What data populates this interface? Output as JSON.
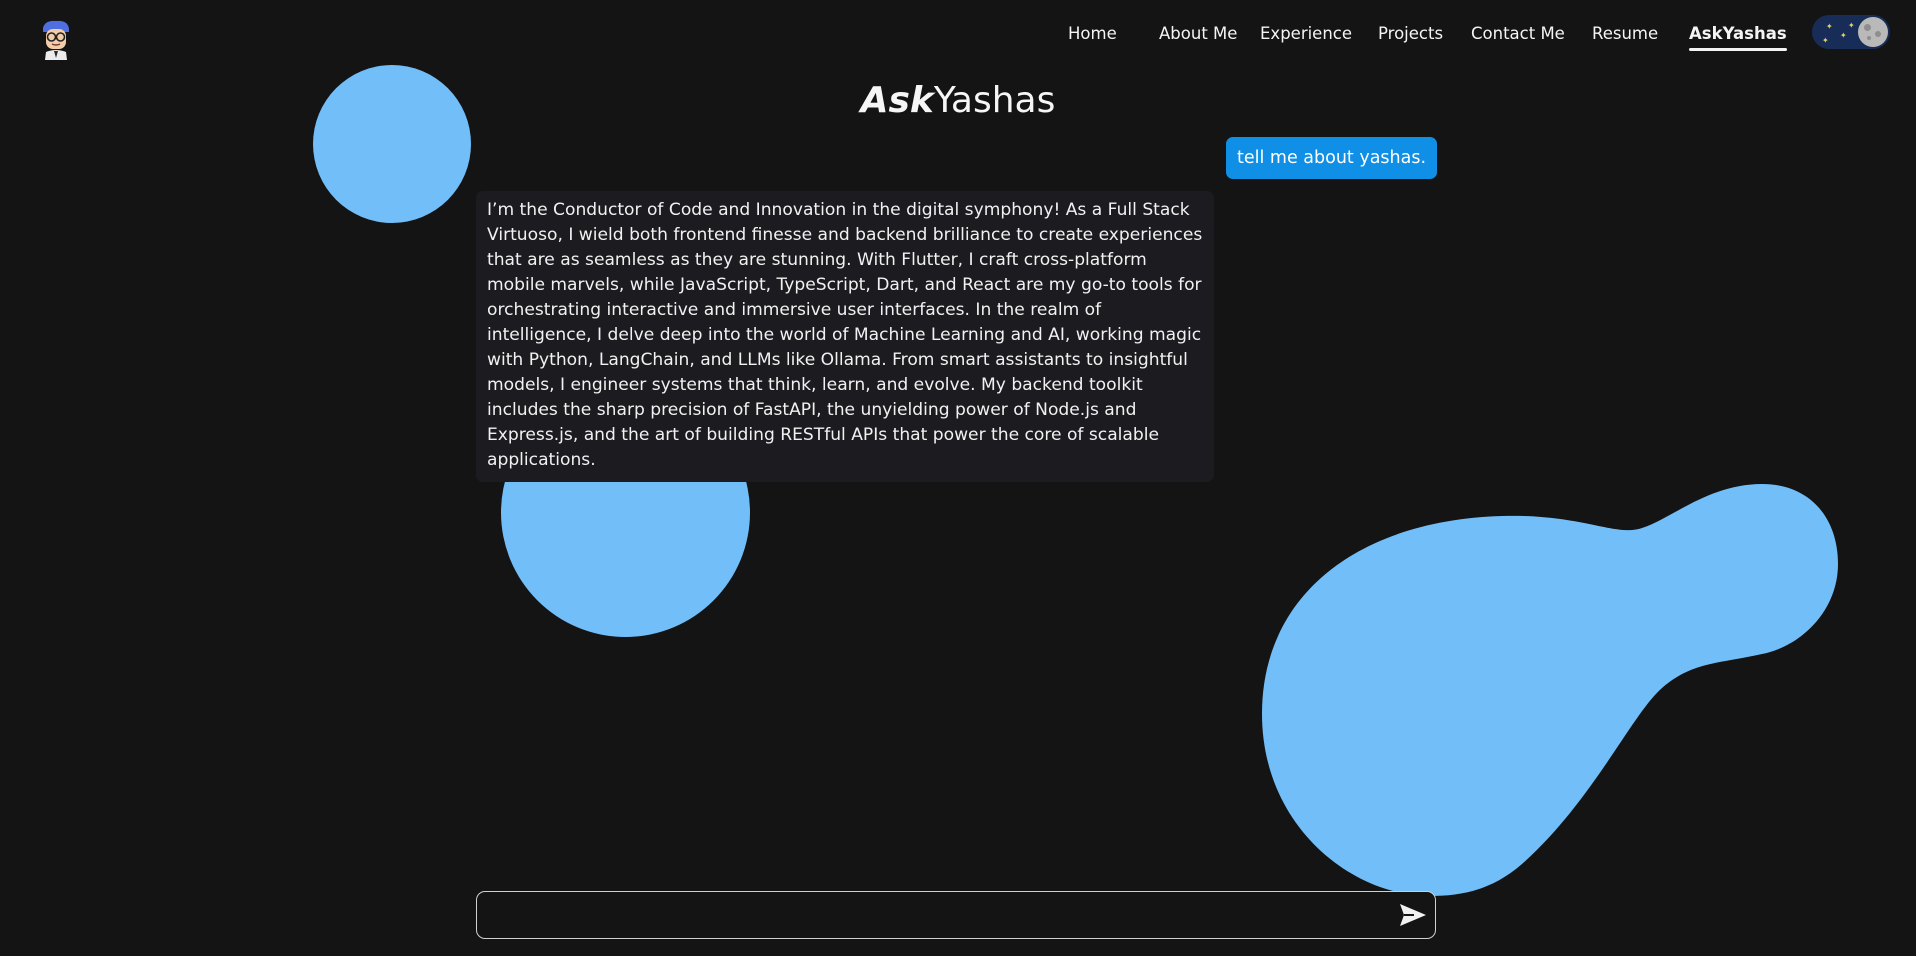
{
  "nav": {
    "items": [
      {
        "label": "Home"
      },
      {
        "label": "About Me"
      },
      {
        "label": "Experience"
      },
      {
        "label": "Projects"
      },
      {
        "label": "Contact Me"
      },
      {
        "label": "Resume"
      },
      {
        "label": "AskYashas",
        "active": true
      }
    ]
  },
  "theme_toggle": {
    "mode": "dark",
    "icon": "moon-icon"
  },
  "title": {
    "prefix": "Ask",
    "name": "Yashas"
  },
  "chat": {
    "user_message": "tell me about yashas.",
    "bot_message": "I’m the Conductor of Code and Innovation in the digital symphony! As a Full Stack Virtuoso, I wield both frontend finesse and backend brilliance to create experiences that are as seamless as they are stunning. With Flutter, I craft cross-platform mobile marvels, while JavaScript, TypeScript, Dart, and React are my go-to tools for orchestrating interactive and immersive user interfaces. In the realm of intelligence, I delve deep into the world of Machine Learning and AI, working magic with Python, LangChain, and LLMs like Ollama. From smart assistants to insightful models, I engineer systems that think, learn, and evolve. My backend toolkit includes the sharp precision of FastAPI, the unyielding power of Node.js and Express.js, and the art of building RESTful APIs that power the core of scalable applications."
  },
  "input": {
    "value": "",
    "placeholder": "",
    "send_icon": "send-icon"
  },
  "colors": {
    "background": "#141414",
    "blob": "#72bef8",
    "user_bubble": "#0f8fe6",
    "bot_bubble": "#1c1c20",
    "toggle_bg": "#172c57"
  }
}
